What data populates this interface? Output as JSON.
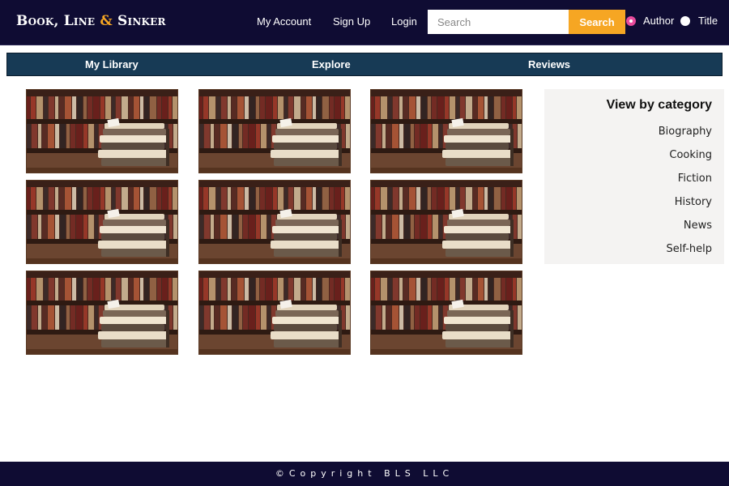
{
  "brand": {
    "name_part1": "Book, Line ",
    "ampersand": "&",
    "name_part2": " Sinker",
    "accent_color": "#f6a623",
    "background_color": "#0f0c33"
  },
  "header": {
    "links": [
      {
        "label": "My Account"
      },
      {
        "label": "Sign Up"
      },
      {
        "label": "Login"
      }
    ],
    "search": {
      "placeholder": "Search",
      "value": "",
      "button_label": "Search"
    },
    "search_by": {
      "options": [
        {
          "label": "Author",
          "selected": true
        },
        {
          "label": "Title",
          "selected": false
        }
      ],
      "selected_color": "#e84b9c"
    }
  },
  "tabs": [
    {
      "label": "My Library"
    },
    {
      "label": "Explore"
    },
    {
      "label": "Reviews"
    }
  ],
  "books": {
    "count": 9,
    "image_description_icon": "book-stack-image"
  },
  "sidebar": {
    "title": "View by category",
    "categories": [
      {
        "label": "Biography"
      },
      {
        "label": "Cooking"
      },
      {
        "label": "Fiction"
      },
      {
        "label": "History"
      },
      {
        "label": "News"
      },
      {
        "label": "Self-help"
      }
    ]
  },
  "footer": {
    "text": "©Copyright BLS LLC"
  }
}
